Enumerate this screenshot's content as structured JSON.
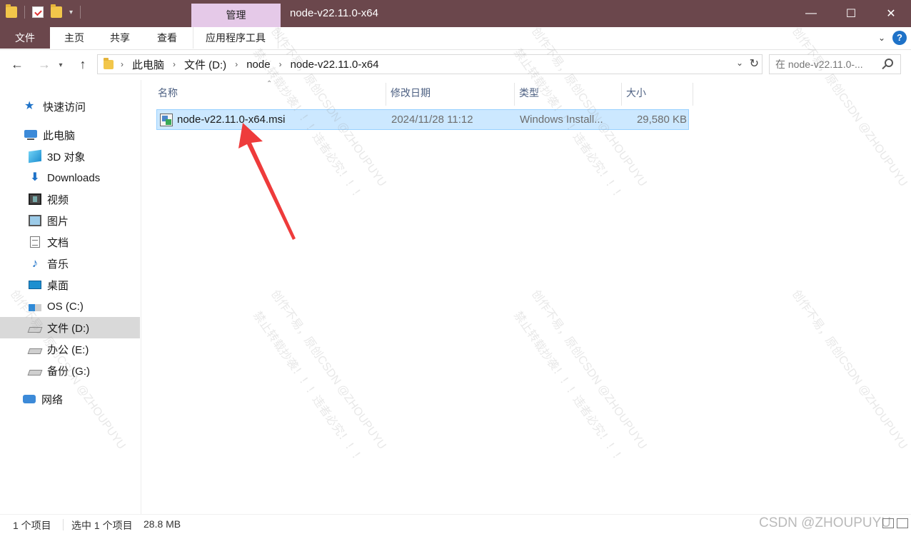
{
  "window": {
    "title": "node-v22.11.0-x64",
    "context_tab": "管理",
    "controls": {
      "minimize": "—",
      "maximize": "☐",
      "close": "✕"
    }
  },
  "ribbon": {
    "tabs": [
      "文件",
      "主页",
      "共享",
      "查看",
      "应用程序工具"
    ],
    "help_label": "?"
  },
  "navigation": {
    "back_glyph": "←",
    "forward_glyph": "→",
    "recent_glyph": "▾",
    "up_glyph": "↑",
    "breadcrumb": [
      "此电脑",
      "文件 (D:)",
      "node",
      "node-v22.11.0-x64"
    ],
    "crumb_separator": "›",
    "dropdown_glyph": "⌄",
    "refresh_glyph": "↻",
    "search_placeholder": "在 node-v22.11.0-..."
  },
  "sidebar": {
    "items": [
      {
        "label": "快速访问",
        "icon": "star-icon"
      },
      {
        "label": "此电脑",
        "icon": "computer-icon"
      },
      {
        "label": "3D 对象",
        "icon": "cube-icon"
      },
      {
        "label": "Downloads",
        "icon": "download-icon"
      },
      {
        "label": "视频",
        "icon": "video-icon"
      },
      {
        "label": "图片",
        "icon": "pictures-icon"
      },
      {
        "label": "文档",
        "icon": "documents-icon"
      },
      {
        "label": "音乐",
        "icon": "music-icon"
      },
      {
        "label": "桌面",
        "icon": "desktop-icon"
      },
      {
        "label": "OS (C:)",
        "icon": "os-drive-icon"
      },
      {
        "label": "文件 (D:)",
        "icon": "drive-icon",
        "selected": true
      },
      {
        "label": "办公 (E:)",
        "icon": "drive-icon"
      },
      {
        "label": "备份 (G:)",
        "icon": "drive-icon"
      },
      {
        "label": "网络",
        "icon": "network-icon"
      }
    ]
  },
  "file_list": {
    "columns": [
      "名称",
      "修改日期",
      "类型",
      "大小"
    ],
    "sort_glyph": "⌃",
    "rows": [
      {
        "name": "node-v22.11.0-x64.msi",
        "modified": "2024/11/28 11:12",
        "type": "Windows Install...",
        "size": "29,580 KB",
        "selected": true
      }
    ]
  },
  "statusbar": {
    "item_count": "1 个项目",
    "selection": "选中 1 个项目",
    "selection_size": "28.8 MB"
  },
  "watermark": {
    "line1": "创作不易，原创CSDN @ZHOUPUYU",
    "line2": "禁止转载抄袭！！！违者必究！！！",
    "corner": "CSDN @ZHOUPUYU"
  },
  "colors": {
    "titlebar": "#6b474c",
    "context_tab": "#e5c9e8",
    "selection_fill": "#cce8ff",
    "selection_border": "#99d1ff",
    "arrow": "#ee3b3b"
  }
}
